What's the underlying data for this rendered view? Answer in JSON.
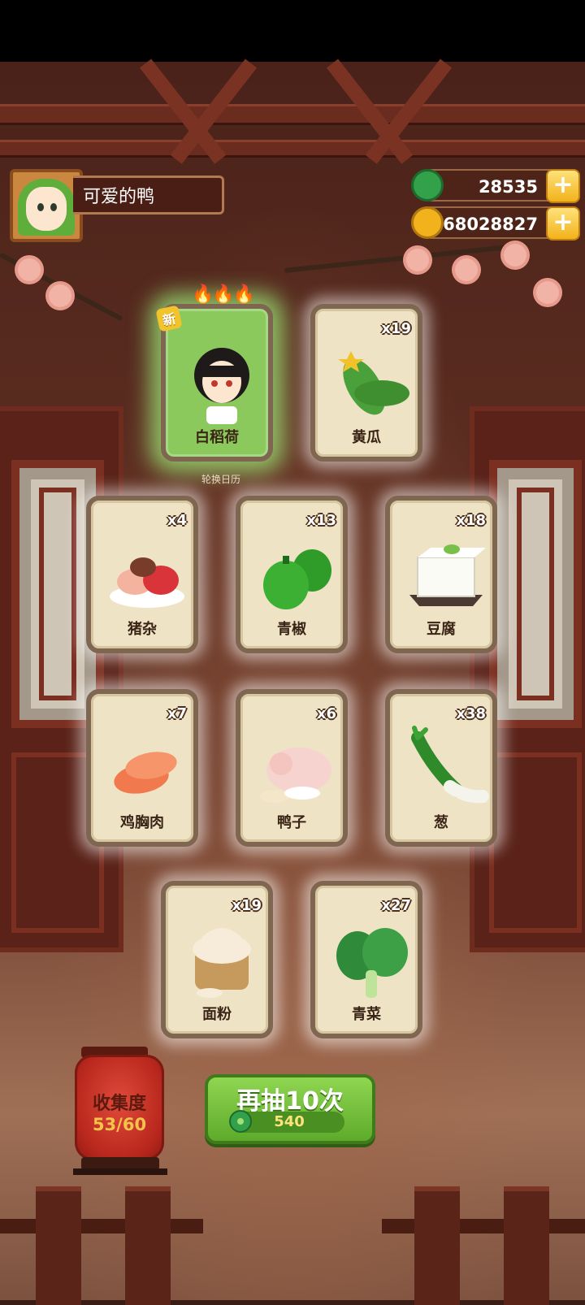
{
  "profile": {
    "name": "可爱的鸭"
  },
  "currency": {
    "jade": {
      "value": "28535",
      "icon": "jade-icon",
      "color": "#33a04a"
    },
    "coins": {
      "value": "68028827",
      "icon": "coin-icon",
      "color": "#f2b21b"
    }
  },
  "cards": [
    {
      "name": "白稻荷",
      "qty": "",
      "is_new": true,
      "new_label": "新",
      "icon": "character-portrait"
    },
    {
      "name": "黄瓜",
      "qty": "x19",
      "icon": "cucumber-icon"
    },
    {
      "name": "猪杂",
      "qty": "x4",
      "icon": "pork-offal-icon"
    },
    {
      "name": "青椒",
      "qty": "x13",
      "icon": "green-pepper-icon"
    },
    {
      "name": "豆腐",
      "qty": "x18",
      "icon": "tofu-icon"
    },
    {
      "name": "鸡胸肉",
      "qty": "x7",
      "icon": "chicken-breast-icon"
    },
    {
      "name": "鸭子",
      "qty": "x6",
      "icon": "duck-icon"
    },
    {
      "name": "葱",
      "qty": "x38",
      "icon": "scallion-icon"
    },
    {
      "name": "面粉",
      "qty": "x19",
      "icon": "flour-icon"
    },
    {
      "name": "青菜",
      "qty": "x27",
      "icon": "greens-icon"
    }
  ],
  "background_label": "轮换日历",
  "collection": {
    "title": "收集度",
    "progress": "53/60"
  },
  "draw": {
    "label": "再抽10次",
    "cost": "540"
  }
}
